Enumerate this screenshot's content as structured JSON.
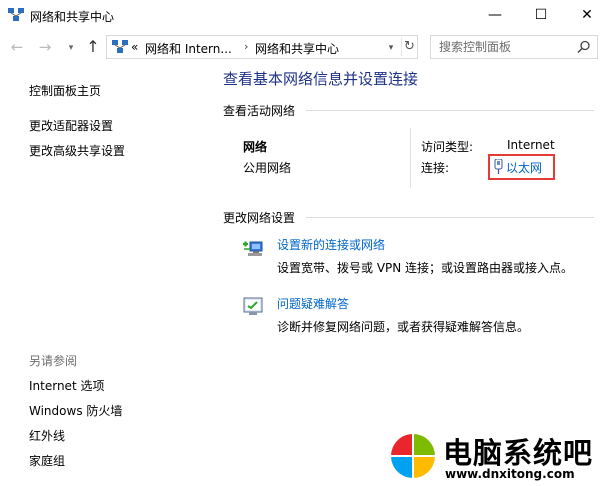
{
  "window": {
    "title": "网络和共享中心",
    "minimize_glyph": "—",
    "maximize_glyph": "☐",
    "close_glyph": "✕"
  },
  "nav": {
    "back_glyph": "←",
    "forward_glyph": "→",
    "history_glyph": "▾",
    "up_glyph": "↑",
    "address": {
      "prefix": "«",
      "crumbs": [
        "网络和 Intern...",
        "网络和共享中心"
      ],
      "separator": "›",
      "dropdown_glyph": "▾",
      "refresh_glyph": "↻"
    },
    "search_placeholder": "搜索控制面板"
  },
  "sidebar": {
    "items": [
      "控制面板主页",
      "更改适配器设置",
      "更改高级共享设置"
    ],
    "see_also_header": "另请参阅",
    "see_also": [
      "Internet 选项",
      "Windows 防火墙",
      "红外线",
      "家庭组"
    ]
  },
  "main": {
    "title": "查看基本网络信息并设置连接",
    "active_networks": {
      "header": "查看活动网络",
      "network_name": "网络",
      "network_type": "公用网络",
      "access_type_label": "访问类型:",
      "access_type_value": "Internet",
      "connections_label": "连接:",
      "connection_link": "以太网"
    },
    "change_settings": {
      "header": "更改网络设置",
      "tasks": [
        {
          "link": "设置新的连接或网络",
          "desc": "设置宽带、拨号或 VPN 连接；或设置路由器或接入点。"
        },
        {
          "link": "问题疑难解答",
          "desc": "诊断并修复网络问题，或者获得疑难解答信息。"
        }
      ]
    }
  },
  "watermark": {
    "title": "电脑系统吧",
    "url": "www.dnxitong.com"
  },
  "colors": {
    "title_blue": "#1e3287",
    "link_blue": "#0066cc",
    "highlight_red": "#e23c34"
  }
}
